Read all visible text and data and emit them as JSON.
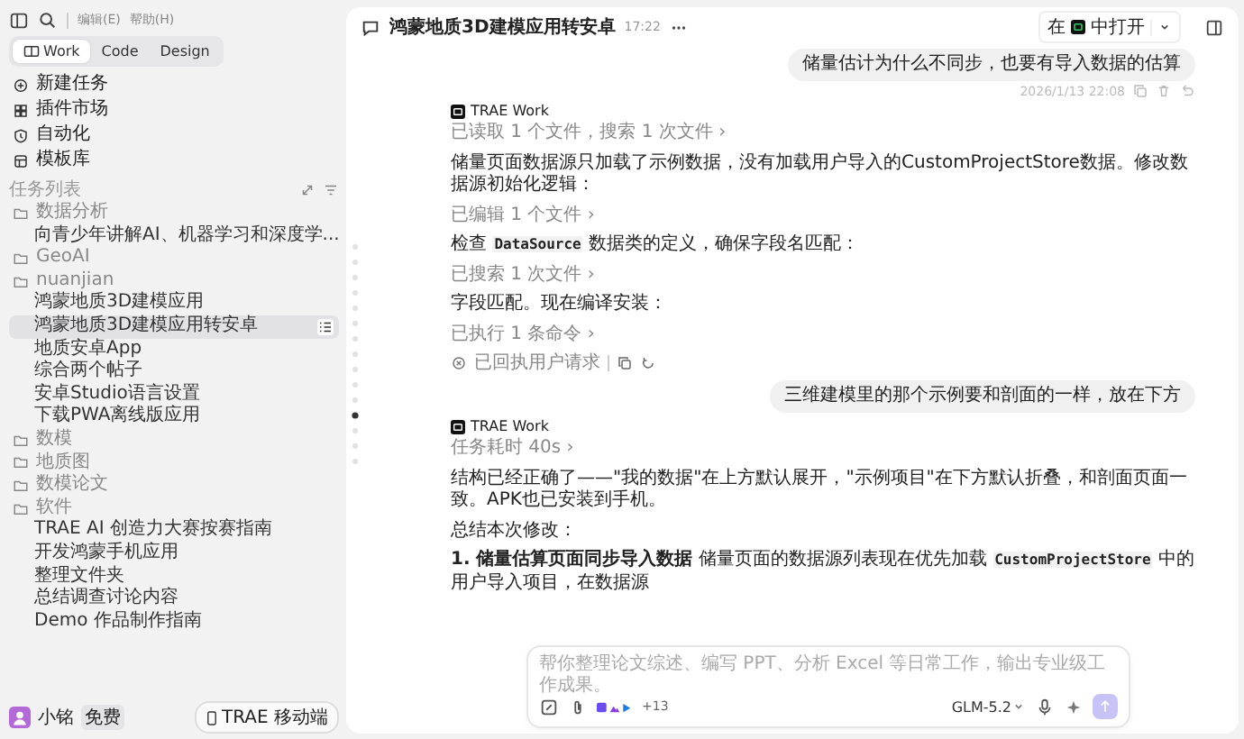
{
  "menu_bar": {
    "items": [
      "编辑(E)",
      "帮助(H)"
    ]
  },
  "mode_tabs": [
    {
      "label": "Work",
      "selected": true
    },
    {
      "label": "Code",
      "selected": false
    },
    {
      "label": "Design",
      "selected": false
    }
  ],
  "nav": [
    {
      "label": "新建任务"
    },
    {
      "label": "插件市场"
    },
    {
      "label": "自动化"
    },
    {
      "label": "模板库"
    }
  ],
  "task_list": {
    "title": "任务列表",
    "folders": [
      {
        "label": "数据分析",
        "children": [
          {
            "label": "向青少年讲解AI、机器学习和深度学...",
            "selected": false
          }
        ]
      },
      {
        "label": "GeoAI"
      },
      {
        "label": "nuanjian",
        "children": [
          {
            "label": "鸿蒙地质3D建模应用",
            "selected": false
          },
          {
            "label": "鸿蒙地质3D建模应用转安卓",
            "selected": true
          },
          {
            "label": "地质安卓App",
            "selected": false
          },
          {
            "label": "综合两个帖子",
            "selected": false
          },
          {
            "label": "安卓Studio语言设置",
            "selected": false
          },
          {
            "label": "下载PWA离线版应用",
            "selected": false
          }
        ]
      },
      {
        "label": "数模"
      },
      {
        "label": "地质图"
      },
      {
        "label": "数模论文"
      },
      {
        "label": "软件",
        "children": [
          {
            "label": "TRAE AI 创造力大赛按赛指南",
            "selected": false
          },
          {
            "label": "开发鸿蒙手机应用",
            "selected": false
          },
          {
            "label": "整理文件夹",
            "selected": false
          },
          {
            "label": "总结调查讨论内容",
            "selected": false
          },
          {
            "label": "Demo 作品制作指南",
            "selected": false
          }
        ]
      }
    ]
  },
  "user": {
    "name": "小铭",
    "plan": "免费"
  },
  "mobile_button": "TRAE 移动端",
  "conversation": {
    "title": "鸿蒙地质3D建模应用转安卓",
    "time": "17:22",
    "open_in_prefix": "在",
    "open_in_suffix": "中打开"
  },
  "messages": [
    {
      "kind": "user",
      "text": "储量估计为什么不同步，也要有导入数据的估算",
      "timestamp": "2026/1/13 22:08"
    },
    {
      "kind": "assistant",
      "author": "TRAE Work",
      "status": "已回执用户请求",
      "blocks": [
        {
          "kind": "step",
          "parts": [
            {
              "kind": "text",
              "text": "已读取 1 个文件，搜索 1 次文件 ›"
            }
          ]
        },
        {
          "kind": "paragraph",
          "parts": [
            {
              "kind": "text",
              "text": "储量页面数据源只加载了示例数据，没有加载用户导入的CustomProjectStore数据。修改数据源初始化逻辑："
            }
          ]
        },
        {
          "kind": "step",
          "parts": [
            {
              "kind": "text",
              "text": "已编辑 1 个文件 ›"
            }
          ]
        },
        {
          "kind": "paragraph",
          "parts": [
            {
              "kind": "text",
              "text": "检查 "
            },
            {
              "kind": "code",
              "text": "DataSource"
            },
            {
              "kind": "text",
              "text": " 数据类的定义，确保字段名匹配："
            }
          ]
        },
        {
          "kind": "step",
          "parts": [
            {
              "kind": "text",
              "text": "已搜索 1 次文件 ›"
            }
          ]
        },
        {
          "kind": "paragraph",
          "parts": [
            {
              "kind": "text",
              "text": "字段匹配。现在编译安装："
            }
          ]
        },
        {
          "kind": "step",
          "parts": [
            {
              "kind": "text",
              "text": "已执行 1 条命令 ›"
            }
          ]
        }
      ]
    },
    {
      "kind": "user",
      "text": "三维建模里的那个示例要和剖面的一样，放在下方"
    },
    {
      "kind": "assistant",
      "author": "TRAE Work",
      "blocks": [
        {
          "kind": "step",
          "parts": [
            {
              "kind": "text",
              "text": "任务耗时 40s ›"
            }
          ]
        },
        {
          "kind": "paragraph",
          "parts": [
            {
              "kind": "text",
              "text": "结构已经正确了——\"我的数据\"在上方默认展开，\"示例项目\"在下方默认折叠，和剖面页面一致。APK也已安装到手机。"
            }
          ]
        },
        {
          "kind": "paragraph",
          "parts": [
            {
              "kind": "text",
              "text": "总结本次修改："
            }
          ]
        },
        {
          "kind": "paragraph",
          "parts": [
            {
              "kind": "bold",
              "text": "1. 储量估算页面同步导入数据"
            },
            {
              "kind": "text",
              "text": " 储量页面的数据源列表现在优先加载 "
            },
            {
              "kind": "code",
              "text": "CustomProjectStore"
            },
            {
              "kind": "text",
              "text": " 中的用户导入项目，在数据源"
            }
          ]
        }
      ]
    }
  ],
  "composer": {
    "placeholder": "帮你整理论文综述、编写 PPT、分析 Excel 等日常工作，输出专业级工作成果。",
    "extra_count": "+13",
    "model": "GLM-5.2"
  }
}
